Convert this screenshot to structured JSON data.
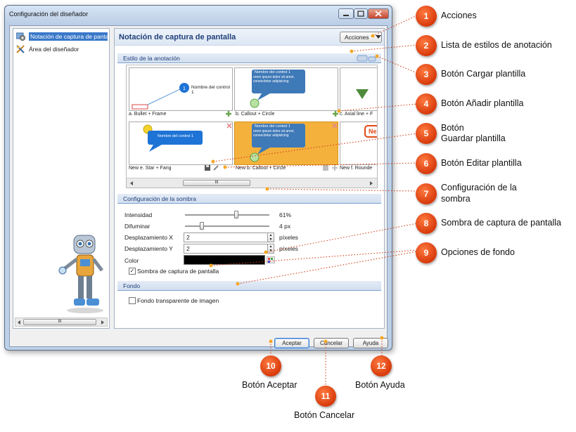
{
  "window": {
    "title": "Configuración del diseñador"
  },
  "tree": {
    "items": [
      {
        "label": "Notación de captura de pantal"
      },
      {
        "label": "Área del diseñador"
      }
    ],
    "scroll_grip": "III"
  },
  "panel": {
    "title": "Notación de captura de pantalla",
    "actions_label": "Acciones"
  },
  "sections": {
    "estilo": "Estilo de la anotación",
    "sombra": "Configuración de la sombra",
    "fondo": "Fondo"
  },
  "gallery": {
    "thumbs": [
      {
        "label": "a. Bullet + Frame",
        "text": "Nombre del control 1"
      },
      {
        "label": "b. Callout + Circle",
        "text": "Nombre del control 1"
      },
      {
        "label": "c. Axial line + F"
      },
      {
        "label": "New e. Star + Fang",
        "text": "Nombre del control 1"
      },
      {
        "label": "New b. Callout + Circle",
        "text": "Nombre del control 1"
      },
      {
        "label": "New f. Rounde",
        "text": "Ne"
      }
    ],
    "bubble_body": "orem ipsum dolor sit amet, consectetur adipisicing",
    "scroll_grip": "III"
  },
  "shadow": {
    "intensity_label": "Intensidad",
    "intensity_value": "61%",
    "intensity_level": 0.61,
    "blur_label": "Difuminar",
    "blur_value": "4 px",
    "blur_level": 0.2,
    "offset_x_label": "Desplazamiento X",
    "offset_x_value": "2",
    "offset_x_unit": "píxeles",
    "offset_y_label": "Desplazamiento Y",
    "offset_y_value": "2",
    "offset_y_unit": "píxeles",
    "color_label": "Color",
    "color_value": "#000000",
    "screenshot_shadow_label": "Sombra de captura de pantalla",
    "screenshot_shadow_checked": true
  },
  "background": {
    "transparent_label": "Fondo transparente de imagen",
    "transparent_checked": false
  },
  "buttons": {
    "accept": "Aceptar",
    "cancel": "Cancelar",
    "help": "Ayuda"
  },
  "callouts": [
    {
      "num": "1",
      "label": "Acciones"
    },
    {
      "num": "2",
      "label": "Lista de estilos de anotación"
    },
    {
      "num": "3",
      "label": "Botón Cargar plantilla"
    },
    {
      "num": "4",
      "label": "Botón Añadir plantilla"
    },
    {
      "num": "5",
      "label_line1": "Botón",
      "label_line2": "Guardar plantilla"
    },
    {
      "num": "6",
      "label": "Botón Editar plantilla"
    },
    {
      "num": "7",
      "label_line1": "Configuración de la",
      "label_line2": "sombra"
    },
    {
      "num": "8",
      "label": "Sombra de captura de pantalla"
    },
    {
      "num": "9",
      "label": "Opciones de fondo"
    },
    {
      "num": "10",
      "label": "Botón Aceptar"
    },
    {
      "num": "11",
      "label": "Botón Cancelar"
    },
    {
      "num": "12",
      "label": "Botón Ayuda"
    }
  ],
  "colors": {
    "badge": "#e04a12",
    "selection": "#3a78c9",
    "selected_thumb": "#f4b23c",
    "section_rule": "#7fa2cf"
  }
}
